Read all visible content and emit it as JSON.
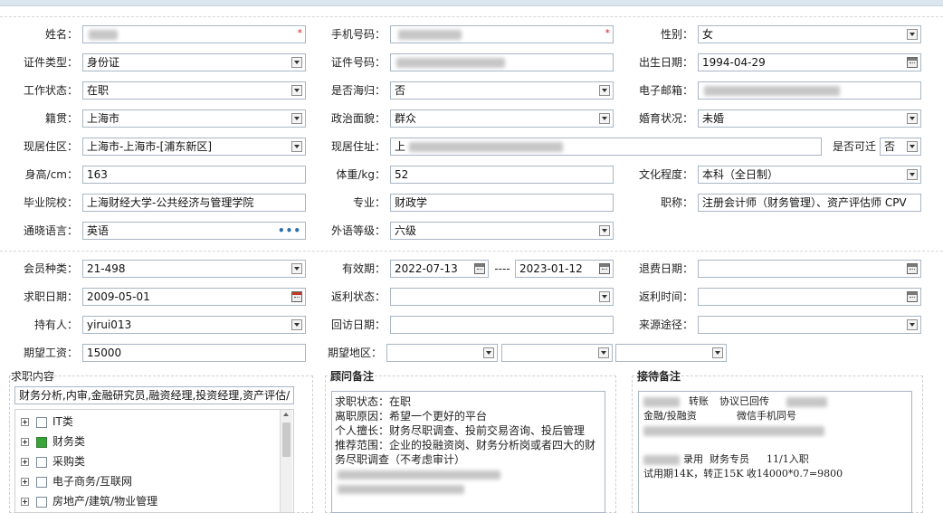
{
  "form": {
    "name_label": "姓名：",
    "phone_label": "手机号码：",
    "gender_label": "性别：",
    "gender_value": "女",
    "idtype_label": "证件类型：",
    "idtype_value": "身份证",
    "idno_label": "证件号码：",
    "birth_label": "出生日期：",
    "birth_value": "1994-04-29",
    "workstatus_label": "工作状态：",
    "workstatus_value": "在职",
    "returnee_label": "是否海归：",
    "returnee_value": "否",
    "email_label": "电子邮箱：",
    "hometown_label": "籍贯：",
    "hometown_value": "上海市",
    "political_label": "政治面貌：",
    "political_value": "群众",
    "marital_label": "婚育状况：",
    "marital_value": "未婚",
    "residence_label": "现居住区：",
    "residence_value": "上海市-上海市-[浦东新区]",
    "address_label": "现居住址：",
    "address_prefix": "上",
    "movable_label": "是否可迁",
    "movable_value": "否",
    "height_label": "身高/cm：",
    "height_value": "163",
    "weight_label": "体重/kg：",
    "weight_value": "52",
    "education_label": "文化程度：",
    "education_value": "本科（全日制）",
    "school_label": "毕业院校：",
    "school_value": "上海财经大学-公共经济与管理学院",
    "major_label": "专业：",
    "major_value": "财政学",
    "title_label": "职称：",
    "title_value": "注册会计师（财务管理）、资产评估师 CPV",
    "language_label": "通晓语言：",
    "language_value": "英语",
    "language_more": "•••",
    "langlevel_label": "外语等级：",
    "langlevel_value": "六级"
  },
  "membership": {
    "type_label": "会员种类：",
    "type_value": "21-498",
    "valid_label": "有效期：",
    "valid_from": "2022-07-13",
    "valid_sep": "----",
    "valid_to": "2023-01-12",
    "refund_label": "退费日期：",
    "job_date_label": "求职日期：",
    "job_date_value": "2009-05-01",
    "rebate_status_label": "返利状态：",
    "rebate_time_label": "返利时间：",
    "holder_label": "持有人：",
    "holder_value": "yirui013",
    "visit_label": "回访日期：",
    "source_label": "来源途径：",
    "salary_label": "期望工资：",
    "salary_value": "15000",
    "region_label": "期望地区："
  },
  "job_content": {
    "title": "求职内容",
    "summary": "财务分析,内审,金融研究员,融资经理,投资经理,资产评估/",
    "tree": [
      {
        "label": "IT类",
        "checked": false
      },
      {
        "label": "财务类",
        "checked": true
      },
      {
        "label": "采购类",
        "checked": false
      },
      {
        "label": "电子商务/互联网",
        "checked": false
      },
      {
        "label": "房地产/建筑/物业管理",
        "checked": false
      }
    ]
  },
  "advisor_notes": {
    "title": "顾问备注",
    "lines": [
      "求职状态：在职",
      "离职原因：希望一个更好的平台",
      "个人擅长：财务尽职调查、投前交易咨询、投后管理",
      "推荐范围：企业的投融资岗、财务分析岗或者四大的财",
      "务尽职调查（不考虑审计）"
    ]
  },
  "reception_notes": {
    "title": "接待备注",
    "line1_a": "转账",
    "line1_b": "协议已回传",
    "line2_a": "金融/投融资",
    "line2_b": "微信手机同号",
    "line3_a": "录用",
    "line3_b": "财务专员",
    "line3_c": "11/1入职",
    "line4": "试用期14K，转正15K 收14000*0.7=9800"
  },
  "colors": {
    "required": "#e01b1b",
    "checked": "#3aa33a",
    "border": "#a8b6c6"
  }
}
